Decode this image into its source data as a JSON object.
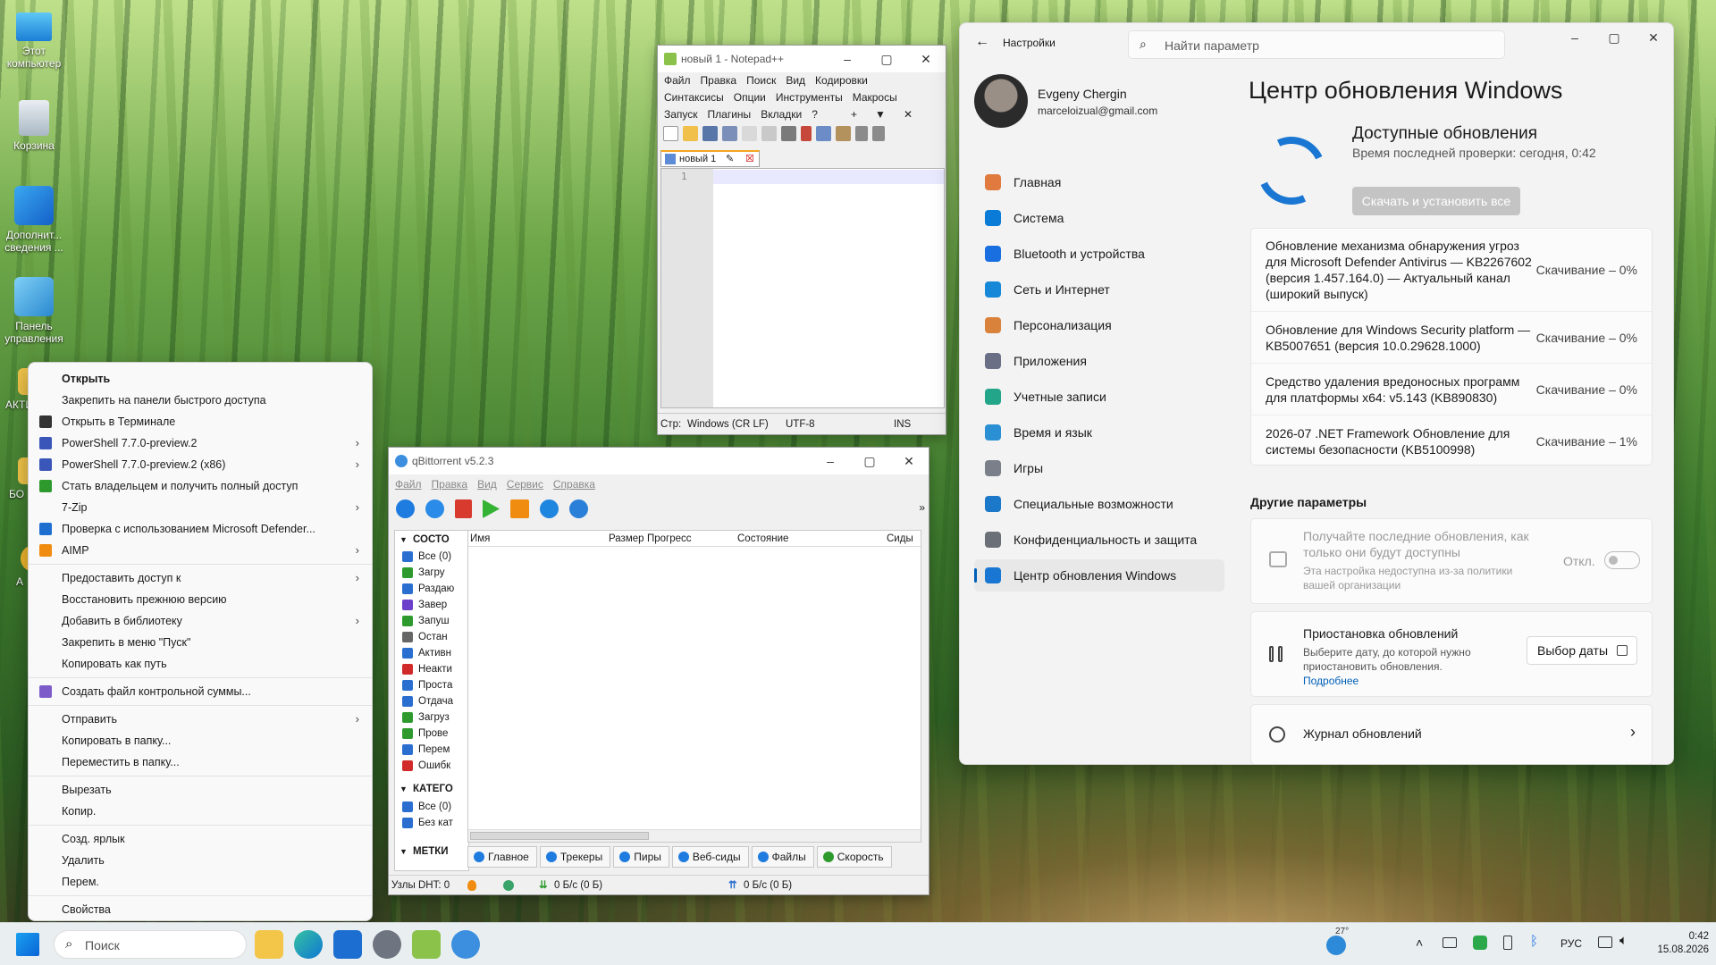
{
  "desktop": {
    "icons": [
      {
        "label": "Этот компьютер"
      },
      {
        "label": "Корзина"
      },
      {
        "label": "Дополнит... сведения ..."
      },
      {
        "label": "Панель управления"
      },
      {
        "label": "АКТИ"
      },
      {
        "label": "БО"
      },
      {
        "label": "А"
      }
    ]
  },
  "context_menu": {
    "items": [
      {
        "label": "Открыть",
        "bold": true
      },
      {
        "label": "Закрепить на панели быстрого доступа"
      },
      {
        "label": "Открыть в Терминале"
      },
      {
        "label": "PowerShell 7.7.0-preview.2",
        "submenu": true
      },
      {
        "label": "PowerShell 7.7.0-preview.2 (x86)",
        "submenu": true
      },
      {
        "label": "Стать владельцем и получить полный доступ"
      },
      {
        "label": "7-Zip",
        "submenu": true
      },
      {
        "label": "Проверка с использованием Microsoft Defender..."
      },
      {
        "label": "AIMP",
        "submenu": true
      },
      {
        "label": "Предоставить доступ к",
        "submenu": true
      },
      {
        "label": "Восстановить прежнюю версию"
      },
      {
        "label": "Добавить в библиотеку",
        "submenu": true
      },
      {
        "label": "Закрепить в меню \"Пуск\""
      },
      {
        "label": "Копировать как путь"
      },
      {
        "label": "Создать файл контрольной суммы..."
      },
      {
        "label": "Отправить",
        "submenu": true
      },
      {
        "label": "Копировать в папку..."
      },
      {
        "label": "Переместить в папку..."
      },
      {
        "label": "Вырезать"
      },
      {
        "label": "Копир."
      },
      {
        "label": "Созд. ярлык"
      },
      {
        "label": "Удалить"
      },
      {
        "label": "Перем."
      },
      {
        "label": "Свойства"
      }
    ],
    "arrow": "›"
  },
  "notepadpp": {
    "title": "новый 1 - Notepad++",
    "menu_row1": [
      "Файл",
      "Правка",
      "Поиск",
      "Вид",
      "Кодировки"
    ],
    "menu_row2": [
      "Синтаксисы",
      "Опции",
      "Инструменты",
      "Макросы"
    ],
    "menu_row3": [
      "Запуск",
      "Плагины",
      "Вкладки",
      "?"
    ],
    "menu_extra": [
      "+",
      "▼",
      "✕"
    ],
    "tab_label": "новый 1",
    "line_number": "1",
    "status": {
      "pos": "Стр:",
      "eol": "Windows (CR LF)",
      "encoding": "UTF-8",
      "mode": "INS"
    }
  },
  "qbittorrent": {
    "title": "qBittorrent v5.2.3",
    "menu": [
      "Файл",
      "Правка",
      "Вид",
      "Сервис",
      "Справка"
    ],
    "status_header": "СОСТО",
    "status_items": [
      "Все (0)",
      "Загру",
      "Раздаю",
      "Завер",
      "Запуш",
      "Остан",
      "Активн",
      "Неакти",
      "Проста",
      "Отдача",
      "Загруз",
      "Прове",
      "Перем",
      "Ошибк"
    ],
    "category_header": "КАТЕГО",
    "category_items": [
      "Все (0)",
      "Без кат"
    ],
    "tags_header": "МЕТКИ",
    "columns": [
      "Имя",
      "Размер",
      "Прогресс",
      "Состояние",
      "Сиды"
    ],
    "bottom_tabs": [
      "Главное",
      "Трекеры",
      "Пиры",
      "Веб-сиды",
      "Файлы",
      "Скорость"
    ],
    "statusbar": {
      "dht": "Узлы DHT: 0",
      "down": "0 Б/с (0 Б)",
      "up": "0 Б/с (0 Б)"
    }
  },
  "settings": {
    "app_title": "Настройки",
    "search_placeholder": "Найти параметр",
    "user": {
      "name": "Evgeny Chergin",
      "email": "marceloizual@gmail.com"
    },
    "nav": [
      {
        "label": "Главная",
        "icon": "home-icon",
        "color": "#e07a3f"
      },
      {
        "label": "Система",
        "icon": "system-icon",
        "color": "#0a7bd6"
      },
      {
        "label": "Bluetooth и устройства",
        "icon": "bluetooth-icon",
        "color": "#1a6fe0"
      },
      {
        "label": "Сеть и Интернет",
        "icon": "network-icon",
        "color": "#1788d8"
      },
      {
        "label": "Персонализация",
        "icon": "brush-icon",
        "color": "#d9823b"
      },
      {
        "label": "Приложения",
        "icon": "apps-icon",
        "color": "#6a6f85"
      },
      {
        "label": "Учетные записи",
        "icon": "accounts-icon",
        "color": "#23a58a"
      },
      {
        "label": "Время и язык",
        "icon": "time-language-icon",
        "color": "#2b8fd4"
      },
      {
        "label": "Игры",
        "icon": "gaming-icon",
        "color": "#7a7f8a"
      },
      {
        "label": "Специальные возможности",
        "icon": "accessibility-icon",
        "color": "#1c78c9"
      },
      {
        "label": "Конфиденциальность и защита",
        "icon": "shield-icon",
        "color": "#6b7078"
      },
      {
        "label": "Центр обновления Windows",
        "icon": "windows-update-icon",
        "color": "#1976d2",
        "active": true
      }
    ],
    "page_title": "Центр обновления Windows",
    "available_title": "Доступные обновления",
    "last_check": "Время последней проверки: сегодня, 0:42",
    "install_button": "Скачать и установить все",
    "updates": [
      {
        "name": "Обновление механизма обнаружения угроз для Microsoft Defender Antivirus — KB2267602 (версия 1.457.164.0) — Актуальный канал (широкий выпуск)",
        "status": "Скачивание – 0%"
      },
      {
        "name": "Обновление для Windows Security platform — KB5007651 (версия 10.0.29628.1000)",
        "status": "Скачивание – 0%"
      },
      {
        "name": "Средство удаления вредоносных программ для платформы x64: v5.143 (KB890830)",
        "status": "Скачивание – 0%"
      },
      {
        "name": "2026-07 .NET Framework Обновление для системы безопасности (KB5100998)",
        "status": "Скачивание – 1%"
      }
    ],
    "other_title": "Другие параметры",
    "latest_updates": {
      "title": "Получайте последние обновления, как только они будут доступны",
      "note": "Эта настройка недоступна из-за политики вашей организации",
      "toggle_label": "Откл."
    },
    "pause": {
      "title": "Приостановка обновлений",
      "desc": "Выберите дату, до которой нужно приостановить обновления.",
      "link": "Подробнее",
      "button": "Выбор даты"
    },
    "history": {
      "title": "Журнал обновлений"
    }
  },
  "taskbar": {
    "search_placeholder": "Поиск",
    "weather": "27°",
    "lang": "РУС",
    "time": "0:42",
    "date": "15.08.2026"
  }
}
